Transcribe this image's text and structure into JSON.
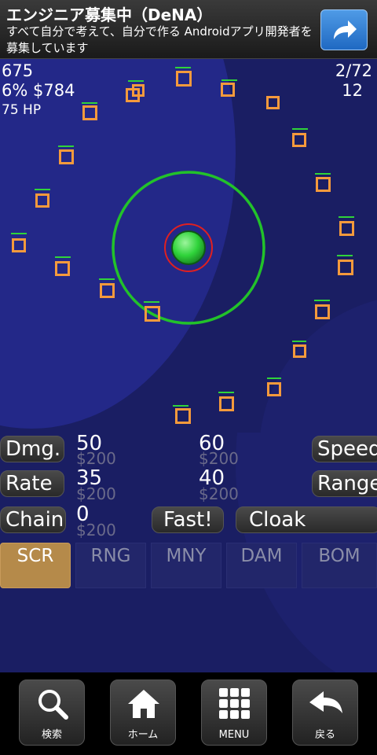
{
  "ad": {
    "title": "エンジニア募集中（DeNA）",
    "body": "すべて自分で考えて、自分で作る Androidアプリ開発者を募集しています",
    "button_icon": "share-arrow-icon"
  },
  "hud": {
    "score": "675",
    "money_line": "6% $784",
    "hp": "75 HP",
    "wave": "2/72",
    "remaining": "12"
  },
  "upgrades": {
    "damage": {
      "label": "Dmg.",
      "value": "50",
      "cost": "$200",
      "next_value": "60",
      "next_cost": "$200"
    },
    "rate": {
      "label": "Rate",
      "value": "35",
      "cost": "$200",
      "next_value": "40",
      "next_cost": "$200"
    },
    "chain": {
      "label": "Chain",
      "value": "0",
      "cost": "$200"
    },
    "speed_label": "Speed",
    "range_label": "Range",
    "fast_label": "Fast!",
    "cloak_label": "Cloak"
  },
  "tabs": [
    {
      "label": "SCR",
      "active": true
    },
    {
      "label": "RNG",
      "active": false
    },
    {
      "label": "MNY",
      "active": false
    },
    {
      "label": "DAM",
      "active": false
    },
    {
      "label": "BOM",
      "active": false
    }
  ],
  "nav": [
    {
      "label": "検索",
      "icon": "search-icon"
    },
    {
      "label": "ホーム",
      "icon": "home-icon"
    },
    {
      "label": "MENU",
      "icon": "grid-menu-icon"
    },
    {
      "label": "戻る",
      "icon": "back-arrow-icon"
    }
  ],
  "colors": {
    "field_bg": "#1a1e63",
    "enemy": "#f59a3c",
    "enemy_hp": "#2fd33a",
    "tower": "#2fd33a",
    "range_ring": "#22c22a",
    "tower_ring": "#e02020",
    "active_tab": "#b58a4a"
  }
}
